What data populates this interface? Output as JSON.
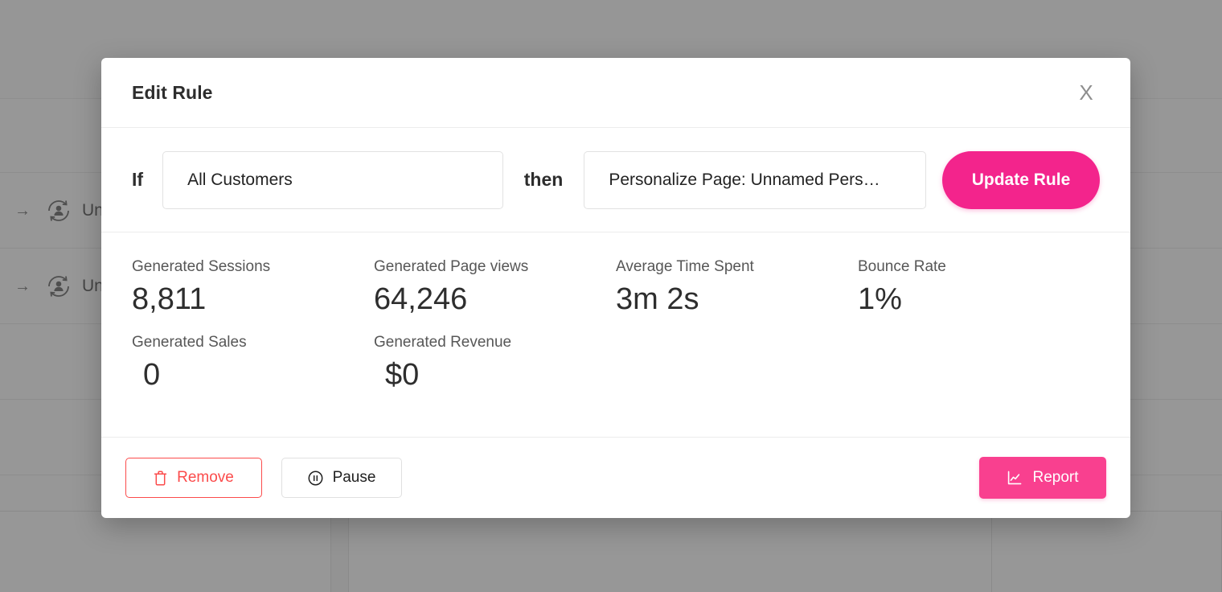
{
  "background": {
    "rows": [
      {
        "arrow_icon": "arrow-right-icon",
        "personalization_icon": "personalization-user-icon",
        "label": "Unn"
      },
      {
        "arrow_icon": "arrow-right-icon",
        "personalization_icon": "personalization-user-icon",
        "label": "Unn"
      }
    ],
    "overlay_color": "#5a5a5a"
  },
  "modal": {
    "title": "Edit Rule",
    "close_icon": "close-icon",
    "close_label": "X",
    "rule": {
      "if_label": "If",
      "segment_value": "All Customers",
      "then_label": "then",
      "experience_value": "Personalize Page: Unnamed Pers…",
      "update_button": "Update Rule"
    },
    "stats": [
      [
        {
          "label": "Generated Sessions",
          "value": "8,811",
          "indent": false
        },
        {
          "label": "Generated Page views",
          "value": "64,246",
          "indent": false
        },
        {
          "label": "Average Time Spent",
          "value": "3m 2s",
          "indent": false
        },
        {
          "label": "Bounce Rate",
          "value": "1%",
          "indent": false
        }
      ],
      [
        {
          "label": "Generated Sales",
          "value": "0",
          "indent": true
        },
        {
          "label": "Generated Revenue",
          "value": "$0",
          "indent": true
        }
      ]
    ],
    "footer": {
      "remove_label": "Remove",
      "remove_icon": "trash-icon",
      "pause_label": "Pause",
      "pause_icon": "pause-circle-icon",
      "report_label": "Report",
      "report_icon": "line-chart-icon"
    }
  },
  "colors": {
    "accent_pink": "#F3248C",
    "report_pink": "#F9408F",
    "danger_red": "#FB4B4B",
    "text_dark": "#2d2d2d",
    "text_muted": "#575757"
  }
}
